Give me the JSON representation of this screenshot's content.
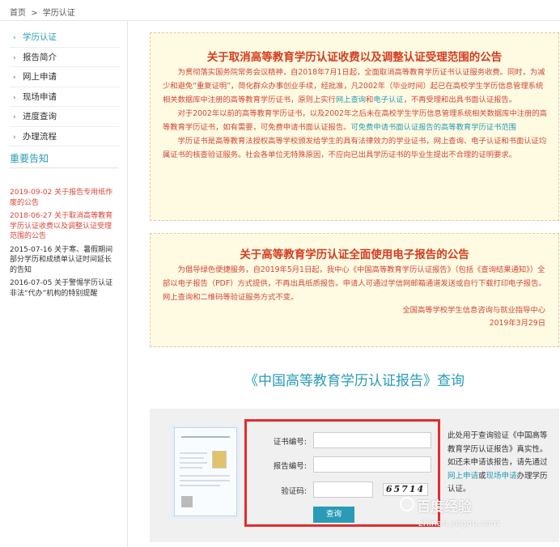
{
  "breadcrumb": {
    "home": "首页",
    "sep": ">",
    "current": "学历认证"
  },
  "sidebar": {
    "items": [
      {
        "label": "学历认证",
        "active": true
      },
      {
        "label": "报告简介"
      },
      {
        "label": "网上申请"
      },
      {
        "label": "现场申请"
      },
      {
        "label": "进度查询"
      },
      {
        "label": "办理流程"
      }
    ],
    "chevron": "›"
  },
  "notices": {
    "title": "重要告知",
    "items": [
      {
        "text": "2019-09-02 关于报告专用纸作废的公告"
      },
      {
        "text": "2018-06-27 关于取消高等教育学历认证收费以及调整认证受理范围的公告"
      },
      {
        "text": "2015-07-16 关于寒、暑假期间部分学历和成绩单认证时间延长的告知"
      },
      {
        "text": "2016-07-05 关于警惕学历认证非法“代办”机构的特别提醒"
      }
    ]
  },
  "announcement1": {
    "title": "关于取消高等教育学历认证收费以及调整认证受理范围的公告",
    "p1_a": "为贯彻落实国务院常务会议精神，自2018年7月1日起，全面取消高等教育学历证书认证服务收费。同时，为减少和避免“重复证明”，简化群众办事创业手续，经批准，凡2002年（毕业时间）起已在高校学生学历信息管理系统相关数据库中注册的高等教育学历证书，原则上实行",
    "p1_link1": "网上查询",
    "p1_and": "和",
    "p1_link2": "电子认证",
    "p1_b": "，不再受理和出具书面认证报告。",
    "p2_a": "对于2002年以前的高等教育学历证书，以及2002年之后未在高校学生学历信息管理系统相关数据库中注册的高等教育学历证书，如有需要，可免费申请书面认证报告。",
    "p2_link": "可免费申请书面认证报告的高等教育学历证书范围",
    "p3": "学历证书是高等教育法授权高等学校颁发给学生的具有法律效力的学业证书，网上查询、电子认证和书面认证均属证书的核查验证服务。社会各单位无特殊原因，不应向已出具学历证书的毕业生提出不合理的证明要求。"
  },
  "announcement2": {
    "title": "关于高等教育学历认证全面使用电子报告的公告",
    "p1": "为倡导绿色便捷服务，自2019年5月1日起，我中心《中国高等教育学历认证报告》（包括《查询结果通知》）全部以电子报告（PDF）方式提供，不再出具纸质报告。申请人可通过学信网邮箱通道发送或自行下载打印电子报告。网上查询和二维码等验证服务方式不变。",
    "sign_org": "全国高等学校学生信息咨询与就业指导中心",
    "sign_date": "2019年3月29日"
  },
  "query": {
    "title": "《中国高等教育学历认证报告》查询",
    "cert_label": "证书编号:",
    "report_label": "报告编号:",
    "captcha_label": "验证码:",
    "cert_value": "",
    "report_value": "",
    "captcha_value": "",
    "captcha_text": "65714",
    "submit_label": "查询",
    "info_a": "此处用于查询验证《中国高等教育学历认证报告》真实性。如还未申请该报告，请先通过",
    "info_link1": "网上申请",
    "info_or": "或",
    "info_link2": "现场申请",
    "info_b": "办理学历认证。"
  },
  "watermark": {
    "text": "百度经验",
    "url": "zhinan.sogou.com"
  },
  "colors": {
    "accent": "#2a9bb6",
    "notice_red": "#d9463a",
    "box_bg": "#fefbe2",
    "highlight": "#e52b2b"
  }
}
